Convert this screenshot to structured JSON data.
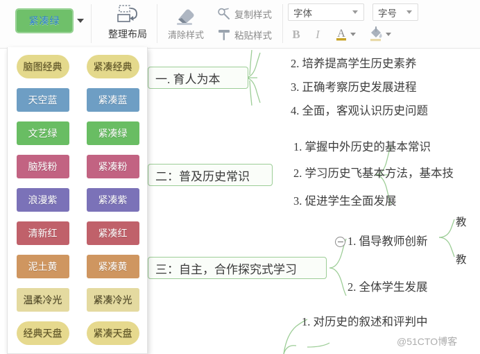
{
  "toolbar": {
    "style_button": {
      "label": "紧凑绿",
      "bg": "#6fc06a",
      "text_color": "#2f7fd0"
    },
    "caret_icon": "chevron-down-icon",
    "layout_button": {
      "label": "整理布局",
      "icon": "arrange-layout-icon"
    },
    "clear_style_button": {
      "label": "清除样式",
      "icon": "eraser-icon"
    },
    "copy_style_button": {
      "label": "复制样式",
      "icon": "copy-style-brush-icon"
    },
    "paste_style_button": {
      "label": "粘贴样式",
      "icon": "paste-style-icon"
    },
    "font_family_select": {
      "value": "字体",
      "placeholder": "字体"
    },
    "font_size_select": {
      "value": "字号",
      "placeholder": "字号"
    },
    "bold_button": {
      "label": "B"
    },
    "italic_button": {
      "label": "I"
    },
    "font_color_button": {
      "label": "A",
      "icon": "font-color-icon",
      "swatch": "#c8a326"
    },
    "highlight_button": {
      "icon": "highlight-bucket-icon",
      "swatch": "#e8d9a8"
    }
  },
  "style_panel": {
    "swatches": [
      {
        "label": "脑图经典",
        "bg": "#e4d98c",
        "fg": "#5a5022",
        "shape": "round"
      },
      {
        "label": "紧凑经典",
        "bg": "#e4d98c",
        "fg": "#5a5022",
        "shape": "round"
      },
      {
        "label": "天空蓝",
        "bg": "#6e9ec4",
        "fg": "#ffffff",
        "shape": "rect"
      },
      {
        "label": "紧凑蓝",
        "bg": "#6e9ec4",
        "fg": "#ffffff",
        "shape": "rect"
      },
      {
        "label": "文艺绿",
        "bg": "#69bd63",
        "fg": "#ffffff",
        "shape": "rect"
      },
      {
        "label": "紧凑绿",
        "bg": "#69bd63",
        "fg": "#ffffff",
        "shape": "rect"
      },
      {
        "label": "脑残粉",
        "bg": "#c26382",
        "fg": "#ffffff",
        "shape": "rect"
      },
      {
        "label": "紧凑粉",
        "bg": "#c26382",
        "fg": "#ffffff",
        "shape": "rect"
      },
      {
        "label": "浪漫紫",
        "bg": "#7b72b8",
        "fg": "#ffffff",
        "shape": "rect"
      },
      {
        "label": "紧凑紫",
        "bg": "#7b72b8",
        "fg": "#ffffff",
        "shape": "rect"
      },
      {
        "label": "清新红",
        "bg": "#c0616a",
        "fg": "#ffffff",
        "shape": "rect"
      },
      {
        "label": "紧凑红",
        "bg": "#c0616a",
        "fg": "#ffffff",
        "shape": "rect"
      },
      {
        "label": "泥土黄",
        "bg": "#cf9660",
        "fg": "#ffffff",
        "shape": "rect"
      },
      {
        "label": "紧凑黄",
        "bg": "#cf9660",
        "fg": "#ffffff",
        "shape": "rect"
      },
      {
        "label": "温柔冷光",
        "bg": "#e4daa0",
        "fg": "#4f4725",
        "shape": "rect"
      },
      {
        "label": "紧凑冷光",
        "bg": "#e4daa0",
        "fg": "#4f4725",
        "shape": "rect"
      },
      {
        "label": "经典天盘",
        "bg": "#e6d98e",
        "fg": "#5a5022",
        "shape": "round"
      },
      {
        "label": "紧凑天盘",
        "bg": "#e6d98e",
        "fg": "#5a5022",
        "shape": "round"
      }
    ]
  },
  "mindmap": {
    "accent": "#9ccd96",
    "node_bg": "#fafdf9",
    "nodes": [
      {
        "label": "一. 育人为本"
      },
      {
        "label": "二：普及历史常识"
      },
      {
        "label": "三：自主，合作探究式学习"
      }
    ],
    "branch1": [
      "2. 培养提高学生历史素养",
      "3. 正确考察历史发展进程",
      "4. 全面，客观认识历史问题"
    ],
    "branch2": [
      "1. 掌握中外历史的基本常识",
      "2. 学习历史飞基本方法，基本技",
      "3. 促进学生全面发展"
    ],
    "branch3": [
      "1. 倡导教师创新",
      "2. 全体学生发展"
    ],
    "branch3_sub": [
      "教",
      "教"
    ],
    "branch4": [
      "1. 对历史的叙述和评判中"
    ]
  },
  "watermark": {
    "text": "@51CTO博客"
  }
}
